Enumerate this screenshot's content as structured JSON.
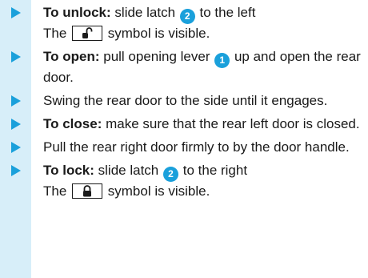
{
  "steps": [
    {
      "label": "To unlock:",
      "text": "slide latch",
      "ref": "2",
      "text2": "to the left",
      "line2_pre": "The",
      "symbol": "unlocked-padlock-icon",
      "line2_post": "symbol is visible."
    },
    {
      "label": "To open:",
      "text": "pull opening lever",
      "ref": "1",
      "text2": "up and open the rear door."
    },
    {
      "text": "Swing the rear door to the side until it engages."
    },
    {
      "label": "To close:",
      "text": "make sure that the rear left door is closed."
    },
    {
      "text": "Pull the rear right door firmly to by the door handle."
    },
    {
      "label": "To lock:",
      "text": "slide latch",
      "ref": "2",
      "text2": "to the right",
      "line2_pre": "The",
      "symbol": "locked-padlock-icon",
      "line2_post": "symbol is visible."
    }
  ],
  "colors": {
    "accent": "#1aa0db",
    "sidebar": "#d7eef9",
    "text": "#1a1a1a"
  }
}
